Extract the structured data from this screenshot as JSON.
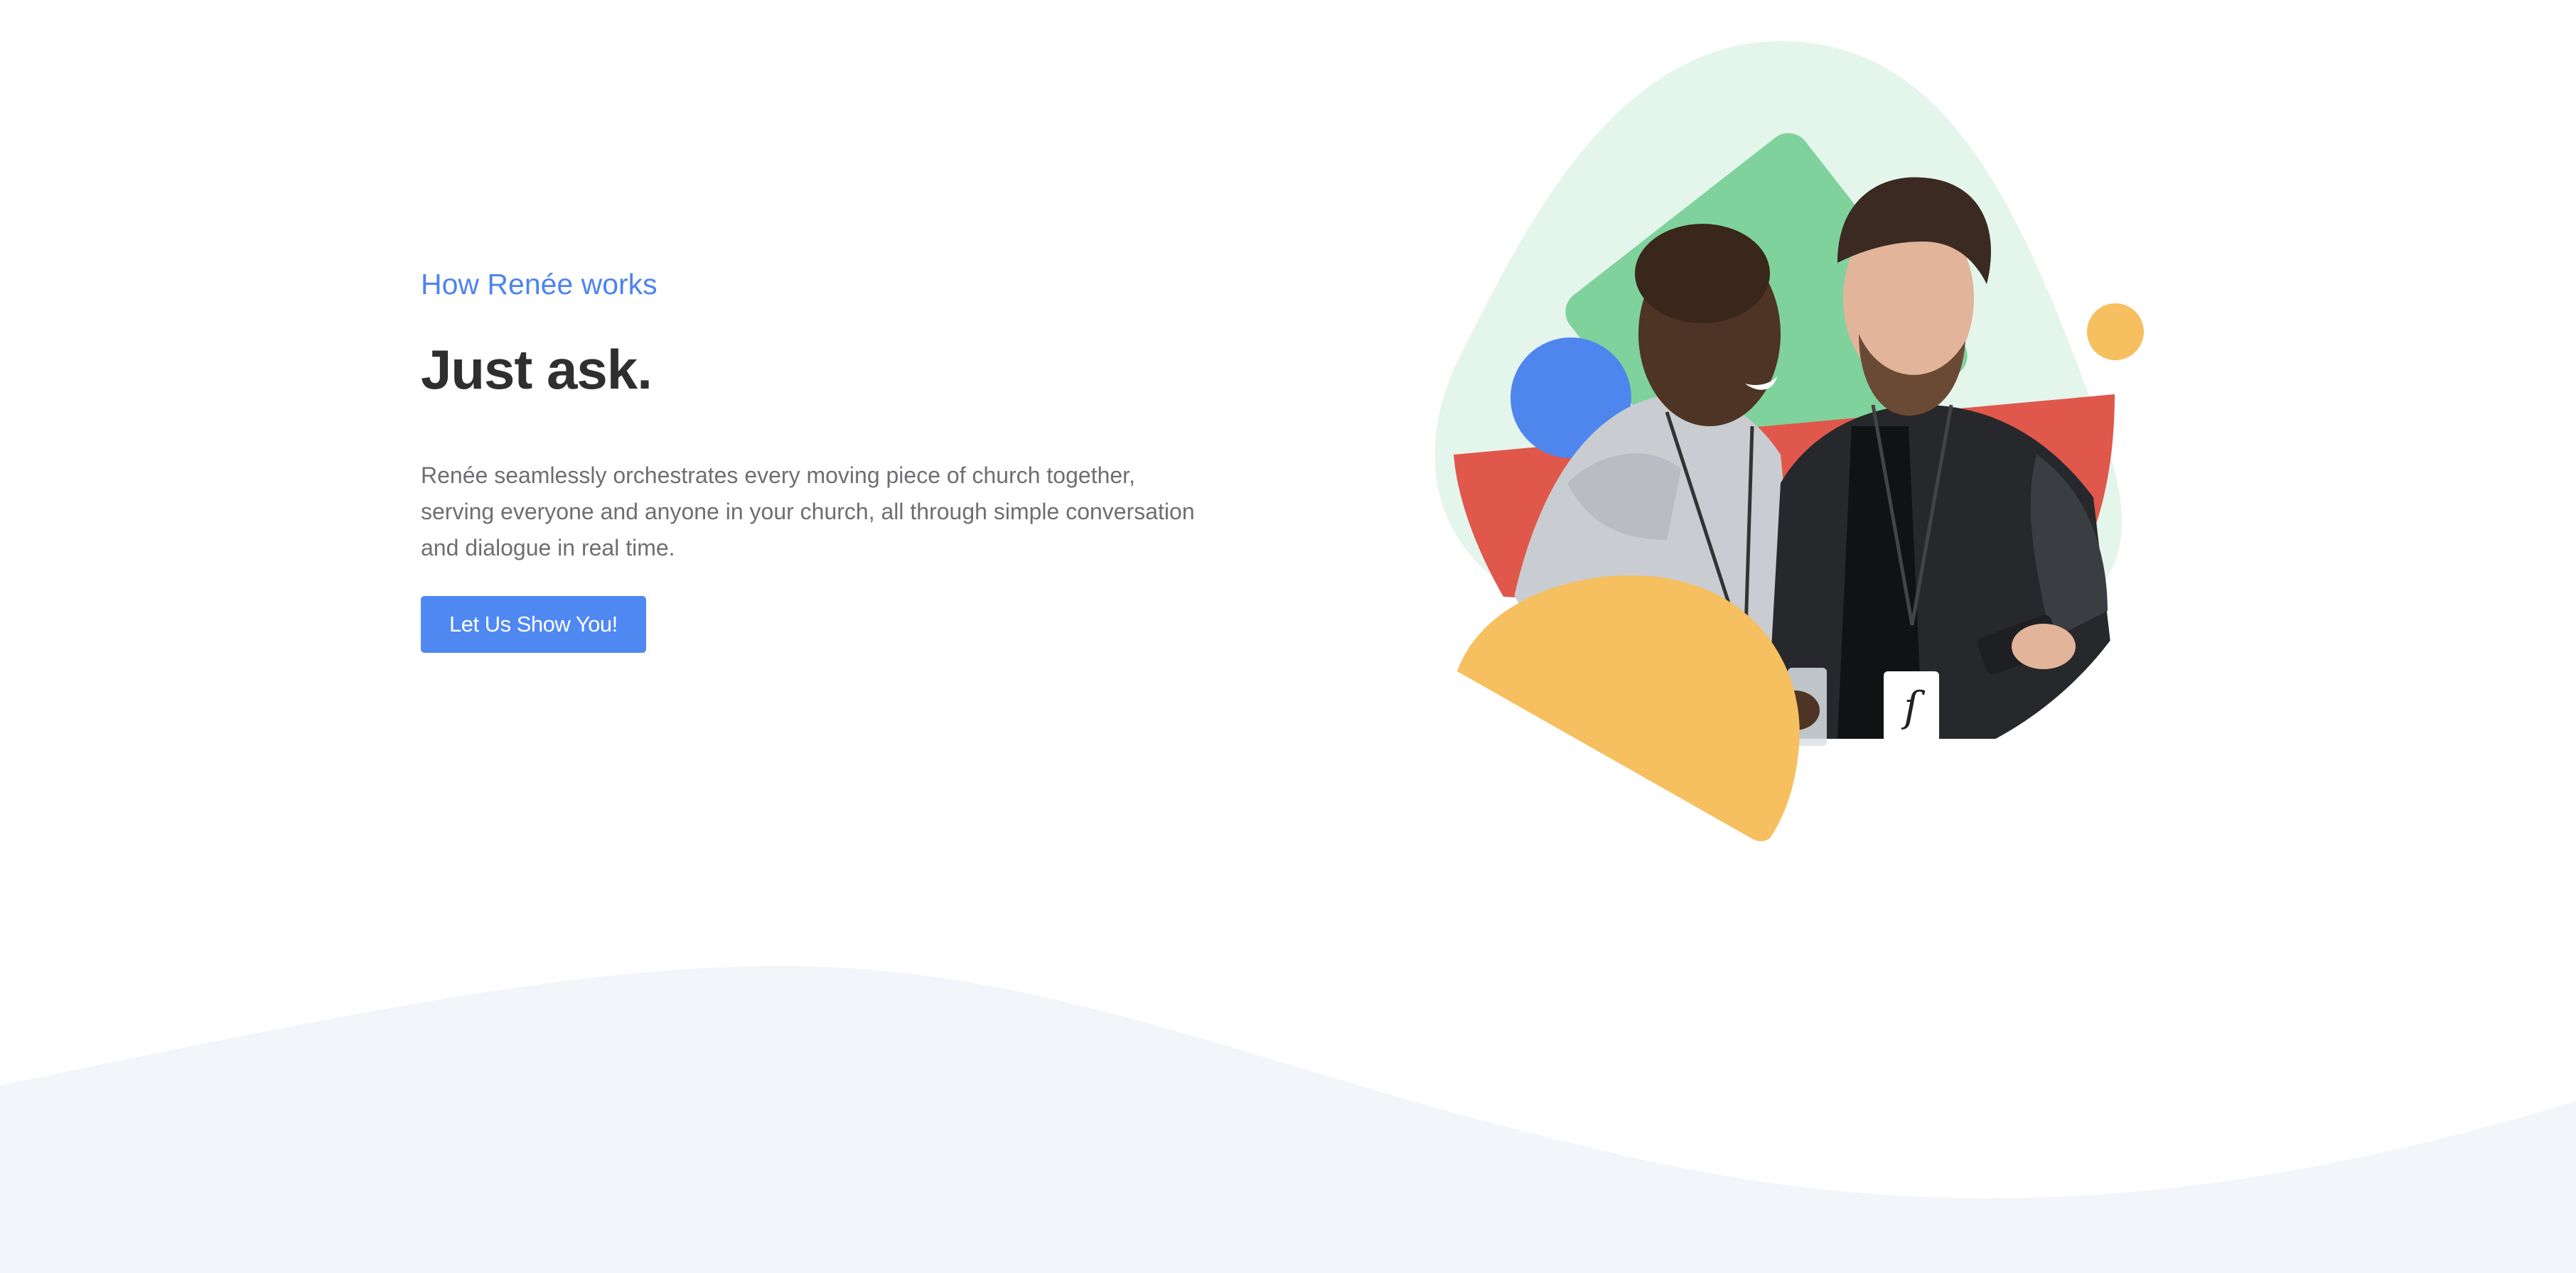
{
  "colors": {
    "accent": "#4d84f0",
    "heading": "#2f2f2f",
    "body_text": "#6e6e73",
    "button_bg": "#5088f2",
    "wave_bg": "#f2f5f9",
    "blob_mint": "#e4f5ec",
    "shape_green": "#7fd29b",
    "shape_blue": "#4e86ee",
    "shape_red": "#e0574b",
    "shape_yellow": "#f6bf5f"
  },
  "hero": {
    "eyebrow": "How Renée works",
    "headline": "Just ask.",
    "description": "Renée seamlessly orchestrates every moving piece of church together, serving everyone and anyone in your church, all through simple conversation and dialogue in real time.",
    "cta_label": "Let Us Show You!"
  },
  "illustration": {
    "badge_icon": "church-logo-icon",
    "shapes": [
      "mint-blob",
      "green-diamond",
      "blue-circle",
      "red-shape",
      "yellow-half-circle",
      "yellow-dot"
    ],
    "photo": "two-people-looking-at-phone"
  }
}
